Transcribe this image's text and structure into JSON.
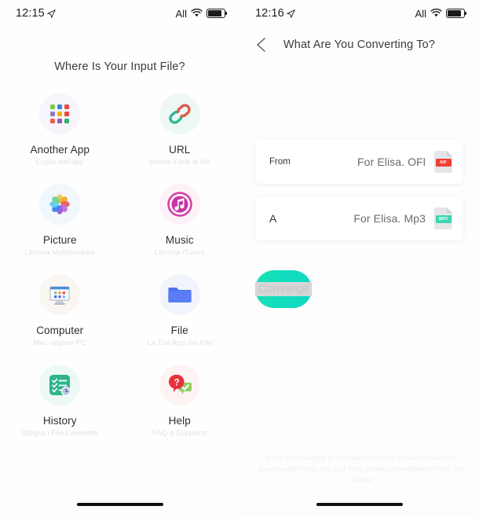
{
  "left": {
    "status": {
      "time": "12:15",
      "loc_icon": "location-arrow-icon",
      "carrier": "All",
      "wifi_icon": "wifi-icon",
      "battery_icon": "battery-icon"
    },
    "title": "Where Is Your Input File?",
    "tiles": [
      {
        "label": "Another App",
        "sub": "Copia dall'app",
        "icon": "app-grid-icon",
        "bg": "#f7f4fb"
      },
      {
        "label": "URL",
        "sub": "Incolla il link al file",
        "icon": "link-chain-icon",
        "bg": "#edf8f4"
      },
      {
        "label": "Picture",
        "sub": "Libreria Multimediale",
        "icon": "photos-flower-icon",
        "bg": "#f2f7fb"
      },
      {
        "label": "Music",
        "sub": "Libreria iTunes",
        "icon": "itunes-note-icon",
        "bg": "#fdf2f8"
      },
      {
        "label": "Computer",
        "sub": "Mac oppure PC",
        "icon": "desktop-computer-icon",
        "bg": "#faf7f3"
      },
      {
        "label": "File",
        "sub": "La Tua App dei File",
        "icon": "folder-icon",
        "bg": "#f1f5fb"
      },
      {
        "label": "History",
        "sub": "Sfoglia i File Convertiti",
        "icon": "checklist-clock-icon",
        "bg": "#edf9f4"
      },
      {
        "label": "Help",
        "sub": "FAQ e Supporto",
        "icon": "question-check-icon",
        "bg": "#fdf3f3"
      }
    ]
  },
  "right": {
    "status": {
      "time": "12:16",
      "loc_icon": "location-arrow-icon",
      "carrier": "All",
      "wifi_icon": "wifi-icon",
      "battery_icon": "battery-icon"
    },
    "back_icon": "back-arrow-icon",
    "title": "What Are You Converting To?",
    "cards": [
      {
        "key": "From",
        "value": "For Elisa. OFl",
        "badge": "AIF",
        "badge_color": "#ef4136"
      },
      {
        "key": "A",
        "value": "For Elisa. Mp3",
        "badge": "MP3",
        "badge_color": "#3fd6b0"
      }
    ],
    "convert_label": "Converge",
    "disclaimer": "Il File Is Uploaded To A Protected Cloud Server, Converted, Downloaded From You And Then Deleted Immediately From The Server"
  },
  "colors": {
    "accent": "#12dcc0",
    "title_text": "#3c3c3c",
    "sub_text": "#e2e2e6"
  }
}
